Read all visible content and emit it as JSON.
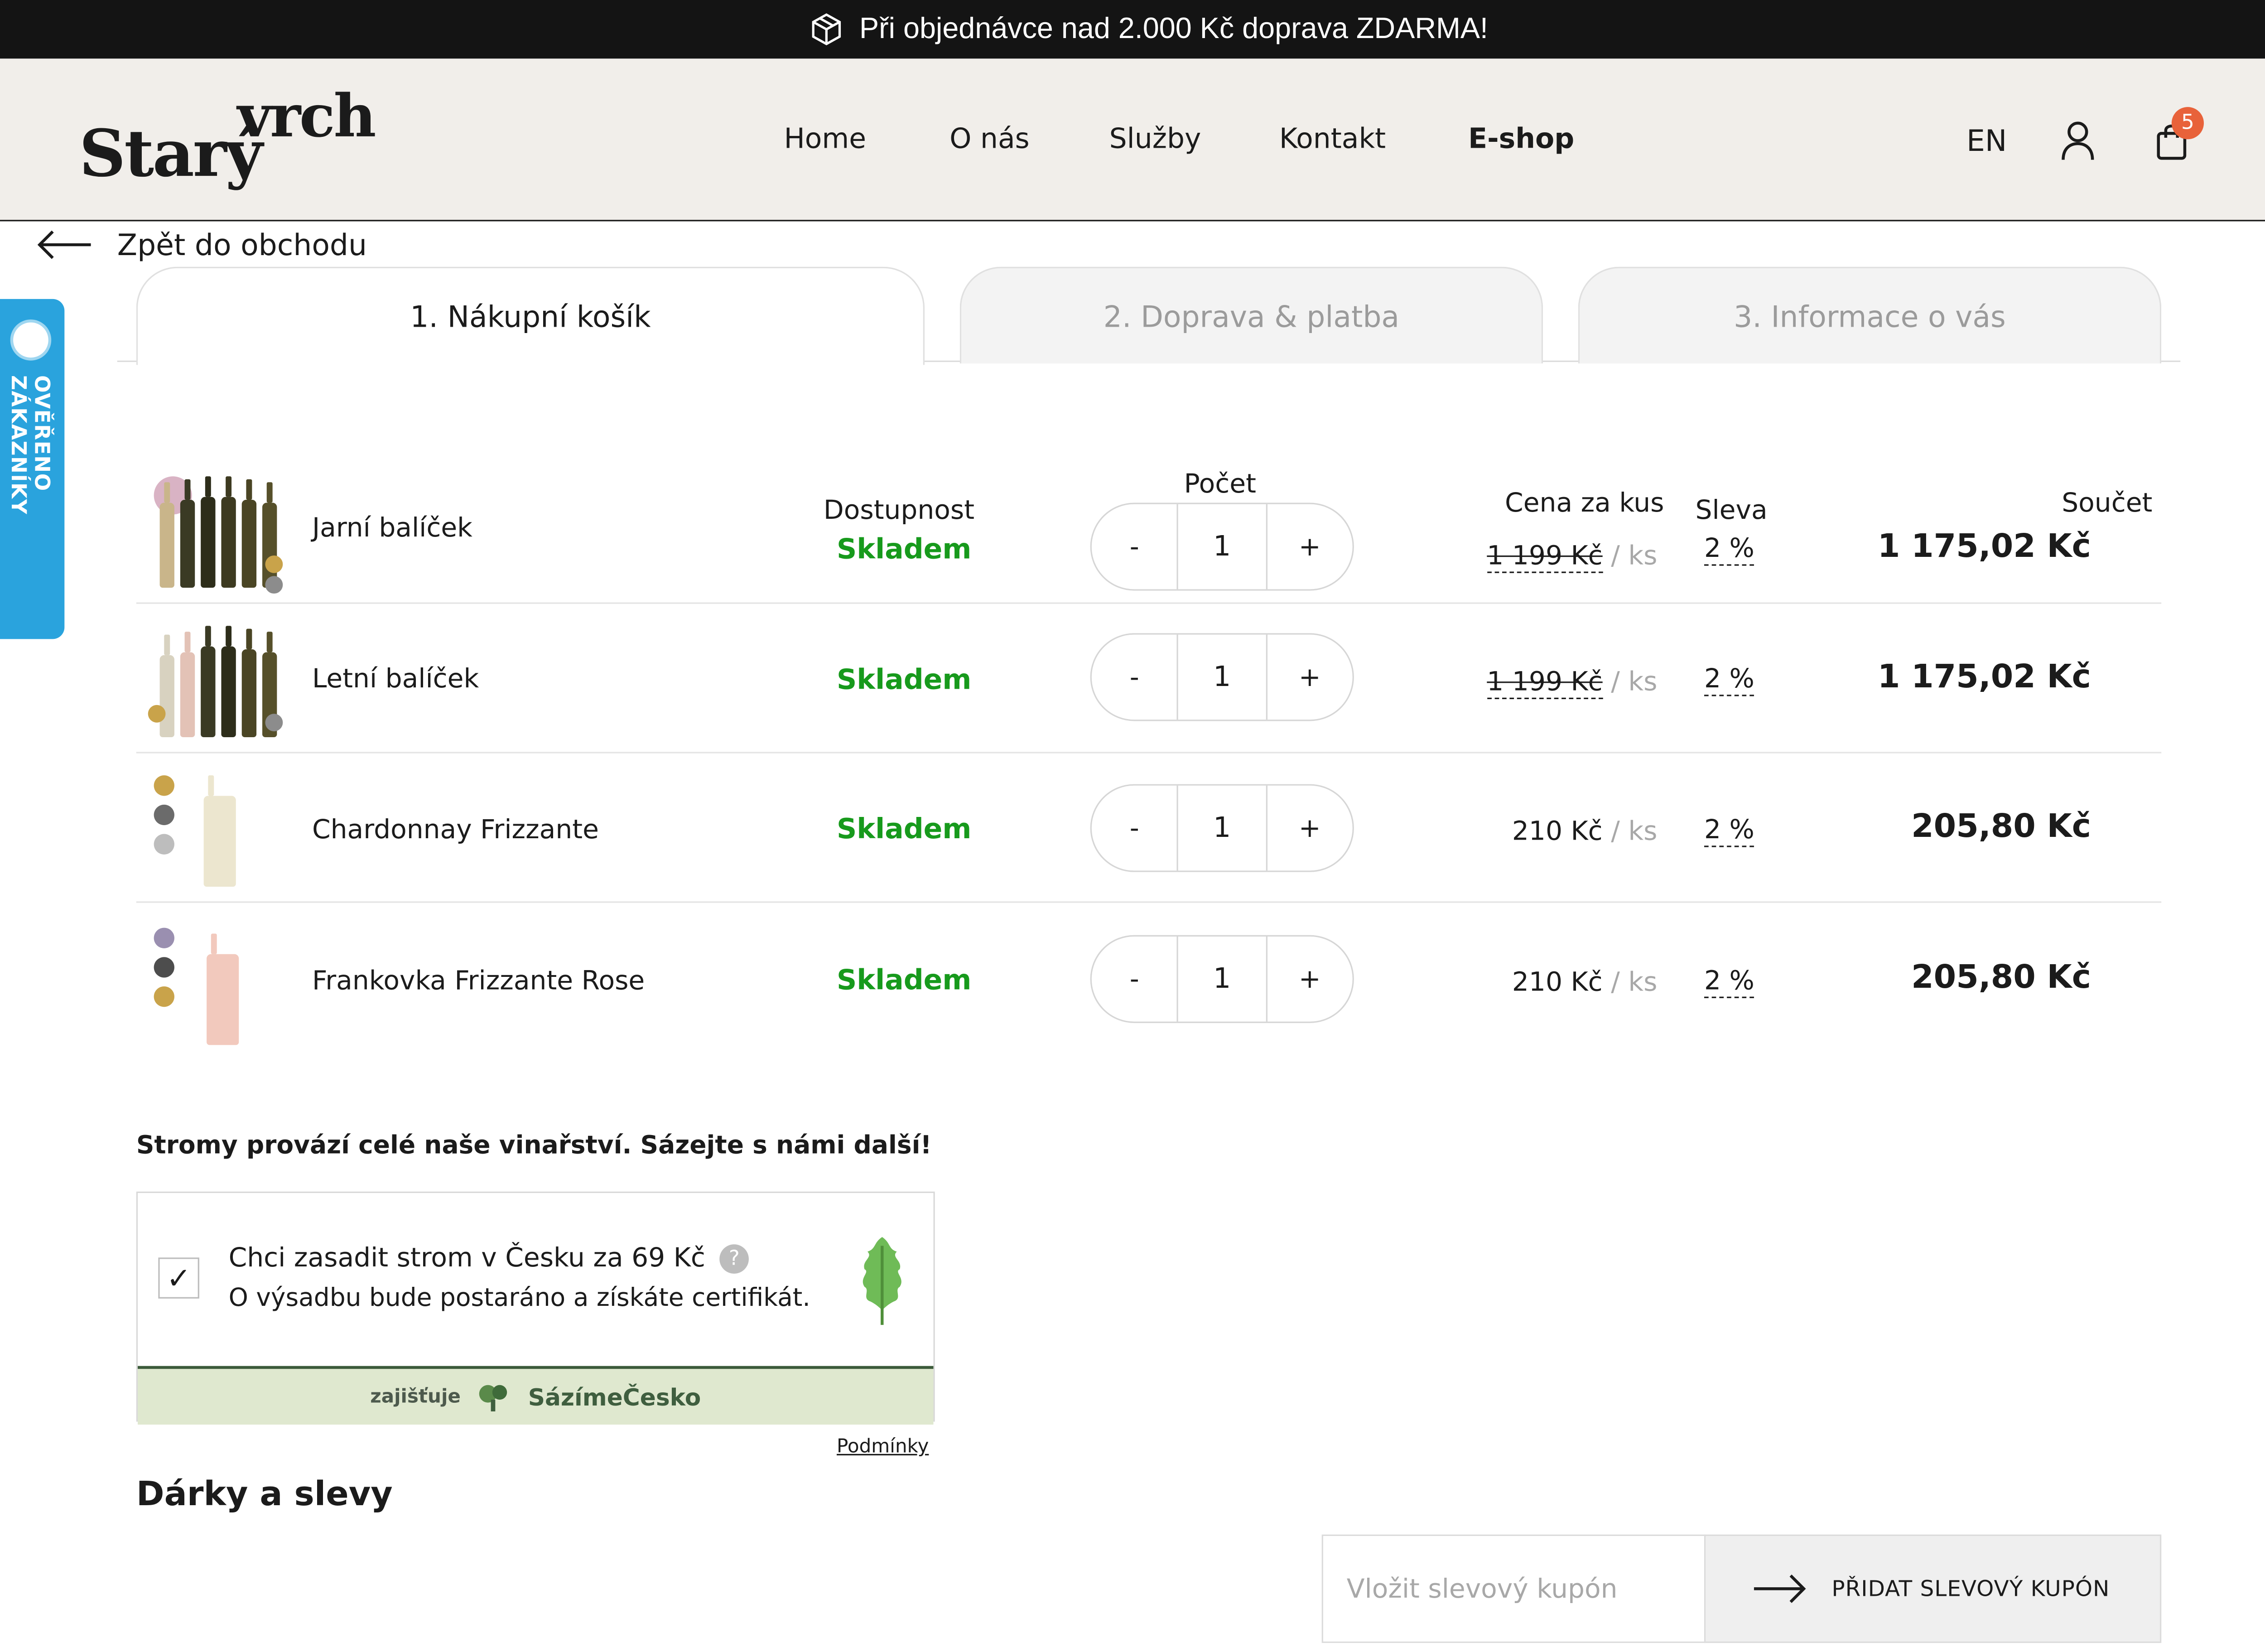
{
  "promo": {
    "text": "Při objednávce nad 2.000 Kč doprava ZDARMA!",
    "icon": "box-icon"
  },
  "header": {
    "logo_line1": "Starý",
    "logo_line2": "vrch",
    "nav": [
      "Home",
      "O nás",
      "Služby",
      "Kontakt",
      "E-shop"
    ],
    "nav_active": "E-shop",
    "lang": "EN",
    "cart_count": "5"
  },
  "back": {
    "label": "Zpět do obchodu"
  },
  "side_badge": {
    "label": "OVĚŘENO ZÁKAZNÍKY"
  },
  "tabs": [
    {
      "label": "1. Nákupní košík"
    },
    {
      "label": "2. Doprava & platba"
    },
    {
      "label": "3. Informace o vás"
    }
  ],
  "columns": {
    "availability": "Dostupnost",
    "quantity": "Počet",
    "unit_price": "Cena za kus",
    "discount": "Sleva",
    "total": "Součet"
  },
  "cart_items": [
    {
      "name": "Jarní balíček",
      "availability": "Skladem",
      "quantity": "1",
      "qty_minus": "-",
      "qty_plus": "+",
      "unit_price": "1 199 Kč",
      "unit_price_struck": true,
      "per_unit": "/ ks",
      "discount": "2 %",
      "total": "1 175,02 Kč"
    },
    {
      "name": "Letní balíček",
      "availability": "Skladem",
      "quantity": "1",
      "qty_minus": "-",
      "qty_plus": "+",
      "unit_price": "1 199 Kč",
      "unit_price_struck": true,
      "per_unit": "/ ks",
      "discount": "2 %",
      "total": "1 175,02 Kč"
    },
    {
      "name": "Chardonnay Frizzante",
      "availability": "Skladem",
      "quantity": "1",
      "qty_minus": "-",
      "qty_plus": "+",
      "unit_price": "210 Kč",
      "unit_price_struck": false,
      "per_unit": "/ ks",
      "discount": "2 %",
      "total": "205,80 Kč"
    },
    {
      "name": "Frankovka Frizzante Rose",
      "availability": "Skladem",
      "quantity": "1",
      "qty_minus": "-",
      "qty_plus": "+",
      "unit_price": "210 Kč",
      "unit_price_struck": false,
      "per_unit": "/ ks",
      "discount": "2 %",
      "total": "205,80 Kč"
    }
  ],
  "tree": {
    "title": "Stromy provází celé naše vinařství. Sázejte s námi další!",
    "checkbox_checked": true,
    "line1": "Chci zasadit strom v Česku za 69 Kč",
    "line2": "O výsadbu bude postaráno a získáte certifikát.",
    "help": "?",
    "provider_prefix": "zajišťuje",
    "provider": "SázímeČesko",
    "terms": "Podmínky"
  },
  "gifts": {
    "title": "Dárky a slevy",
    "coupon_placeholder": "Vložit slevový kupón",
    "coupon_button": "PŘIDAT SLEVOVÝ KUPÓN"
  },
  "colors": {
    "accent_green": "#179a1c",
    "badge_orange": "#e8623a",
    "side_blue": "#2aa3dd",
    "header_bg": "#f1eeea"
  }
}
